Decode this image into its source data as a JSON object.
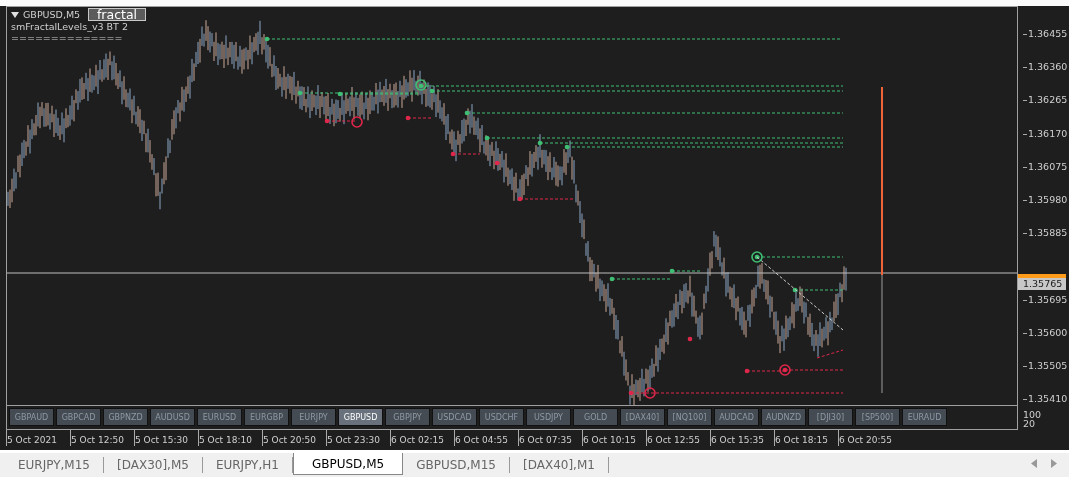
{
  "chart": {
    "symbol": "GBPUSD,M5",
    "indicator_button": "fractal",
    "indicator_name": "smFractalLevels_v3 BT 2",
    "separator": "==============",
    "price_axis": [
      "1.36455",
      "1.36360",
      "1.36265",
      "1.36170",
      "1.36075",
      "1.35980",
      "1.35885",
      "1.35695",
      "1.35600",
      "1.35505",
      "1.35410"
    ],
    "current_price": "1.35765",
    "symbol_buttons": [
      {
        "label": "GBPAUD",
        "selected": false
      },
      {
        "label": "GBPCAD",
        "selected": false
      },
      {
        "label": "GBPNZD",
        "selected": false
      },
      {
        "label": "AUDUSD",
        "selected": false
      },
      {
        "label": "EURUSD",
        "selected": false
      },
      {
        "label": "EURGBP",
        "selected": false
      },
      {
        "label": "EURJPY",
        "selected": false
      },
      {
        "label": "GBPUSD",
        "selected": true
      },
      {
        "label": "GBPJPY",
        "selected": false
      },
      {
        "label": "USDCAD",
        "selected": false
      },
      {
        "label": "USDCHF",
        "selected": false
      },
      {
        "label": "USDJPY",
        "selected": false
      },
      {
        "label": "GOLD",
        "selected": false
      },
      {
        "label": "[DAX40]",
        "selected": false
      },
      {
        "label": "[NQ100]",
        "selected": false
      },
      {
        "label": "AUDCAD",
        "selected": false
      },
      {
        "label": "AUDNZD",
        "selected": false
      },
      {
        "label": "[DJI30]",
        "selected": false
      },
      {
        "label": "[SP500]",
        "selected": false
      },
      {
        "label": "EURAUD",
        "selected": false
      }
    ],
    "indicator_scale": [
      "100",
      "20"
    ],
    "time_axis": [
      "5 Oct 2021",
      "5 Oct 12:50",
      "5 Oct 15:30",
      "5 Oct 18:10",
      "5 Oct 20:50",
      "5 Oct 23:30",
      "6 Oct 02:15",
      "6 Oct 04:55",
      "6 Oct 07:35",
      "6 Oct 10:15",
      "6 Oct 12:55",
      "6 Oct 15:35",
      "6 Oct 18:15",
      "6 Oct 20:55"
    ]
  },
  "tabs": [
    {
      "label": "EURJPY,M15",
      "selected": false
    },
    {
      "label": "[DAX30],M5",
      "selected": false
    },
    {
      "label": "EURJPY,H1",
      "selected": false
    },
    {
      "label": "GBPUSD,M5",
      "selected": true
    },
    {
      "label": "GBPUSD,M15",
      "selected": false
    },
    {
      "label": "[DAX40],M1",
      "selected": false
    }
  ]
}
